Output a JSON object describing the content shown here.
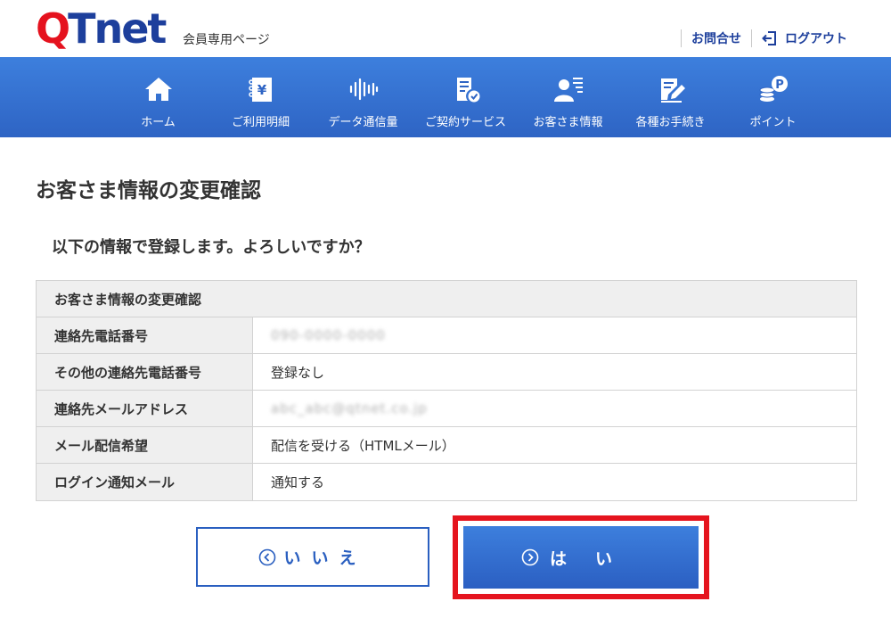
{
  "header": {
    "logo_q": "Q",
    "logo_tnet": "Tnet",
    "subtitle": "会員専用ページ",
    "contact_label": "お問合せ",
    "logout_label": "ログアウト"
  },
  "nav": {
    "items": [
      {
        "label": "ホーム",
        "icon": "home-icon"
      },
      {
        "label": "ご利用明細",
        "icon": "billing-icon"
      },
      {
        "label": "データ通信量",
        "icon": "data-usage-icon"
      },
      {
        "label": "ご契約サービス",
        "icon": "contract-icon"
      },
      {
        "label": "お客さま情報",
        "icon": "customer-info-icon"
      },
      {
        "label": "各種お手続き",
        "icon": "procedure-icon"
      },
      {
        "label": "ポイント",
        "icon": "points-icon"
      }
    ]
  },
  "main": {
    "title": "お客さま情報の変更確認",
    "question": "以下の情報で登録します。よろしいですか？",
    "table": {
      "header": "お客さま情報の変更確認",
      "rows": [
        {
          "label": "連絡先電話番号",
          "value": "090-0000-0000"
        },
        {
          "label": "その他の連絡先電話番号",
          "value": "登録なし"
        },
        {
          "label": "連絡先メールアドレス",
          "value": "abc_abc@qtnet.co.jp"
        },
        {
          "label": "メール配信希望",
          "value": "配信を受ける（HTMLメール）"
        },
        {
          "label": "ログイン通知メール",
          "value": "通知する"
        }
      ]
    },
    "buttons": {
      "no_label": "いいえ",
      "yes_label": "はい"
    }
  },
  "colors": {
    "brand_red": "#e5121e",
    "brand_blue": "#1d3f9c",
    "nav_blue": "#3d7fdd",
    "highlight_red": "#e5141e"
  }
}
